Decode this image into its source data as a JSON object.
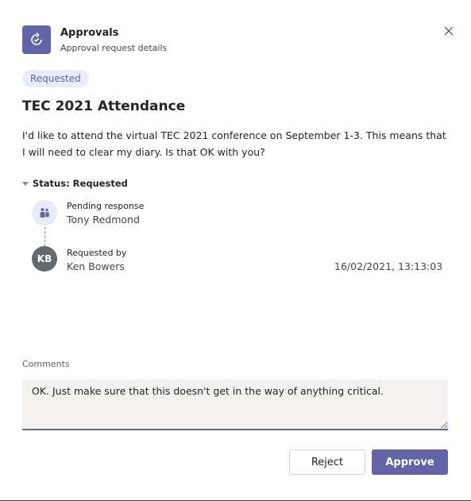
{
  "header": {
    "app_icon": "approvals-icon",
    "app_title": "Approvals",
    "app_subtitle": "Approval request details",
    "close_icon": "close-icon"
  },
  "request": {
    "status_pill": "Requested",
    "title": "TEC 2021 Attendance",
    "description": "I'd like to attend the virtual TEC 2021 conference on September 1-3. This means that I will need to clear my diary. Is that OK with you?"
  },
  "status": {
    "toggle_label": "Status: Requested",
    "steps": [
      {
        "label": "Pending response",
        "name": "Tony Redmond",
        "avatar_icon": "teams-people-icon"
      },
      {
        "label": "Requested by",
        "name": "Ken Bowers",
        "avatar_initials": "KB",
        "timestamp": "16/02/2021, 13:13:03"
      }
    ]
  },
  "comments": {
    "label": "Comments",
    "value": "OK. Just make sure that this doesn't get in the way of anything critical."
  },
  "actions": {
    "reject_label": "Reject",
    "approve_label": "Approve"
  },
  "colors": {
    "accent": "#6264a7",
    "pill_bg": "#e8ebfa",
    "avatar_bg": "#5f6b6e"
  }
}
